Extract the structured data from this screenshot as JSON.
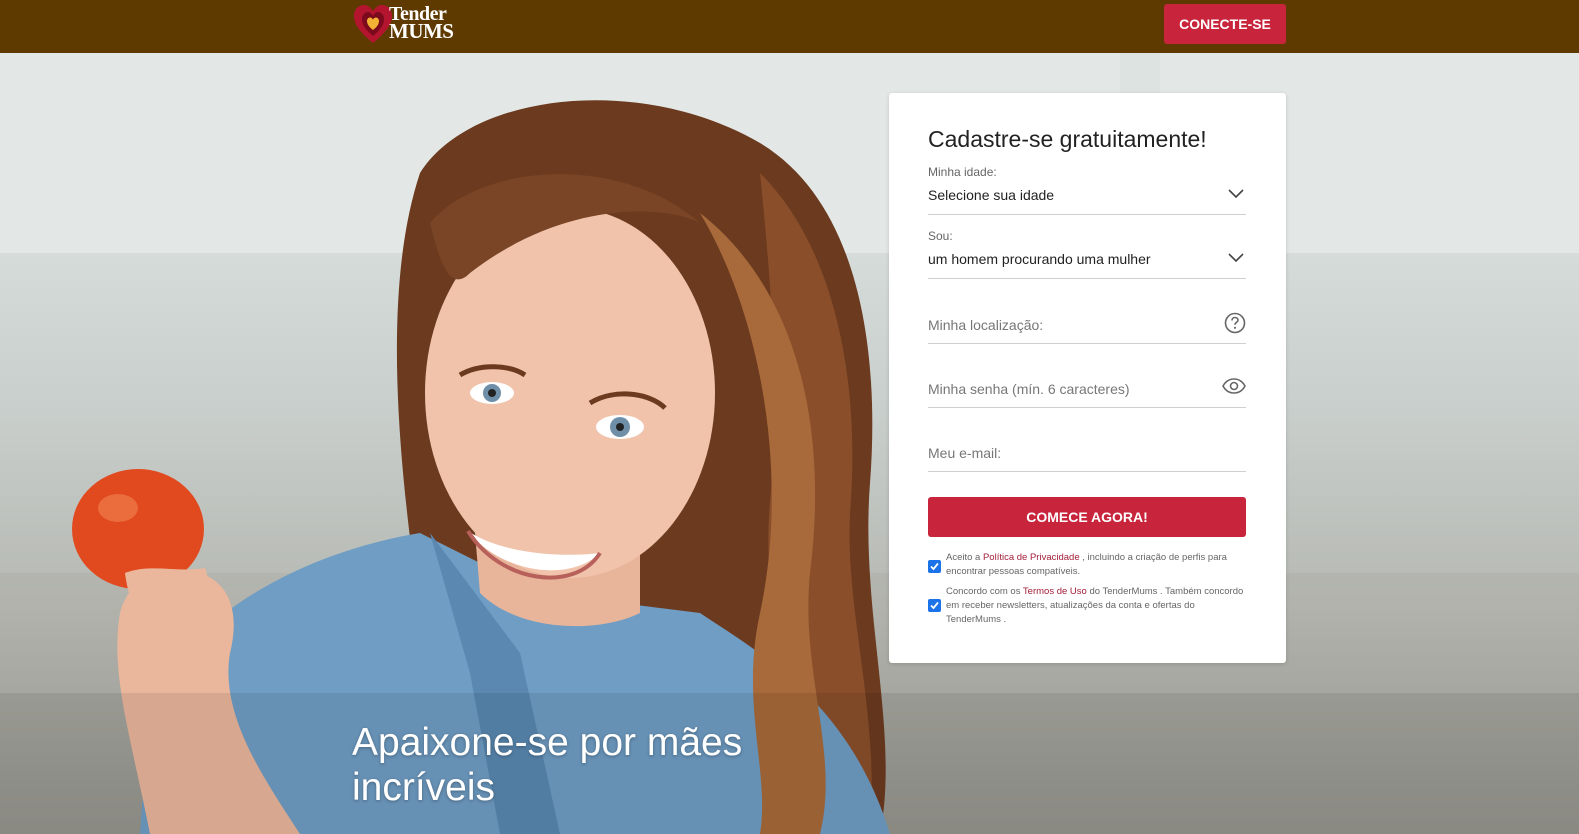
{
  "header": {
    "logo_line1": "Tender",
    "logo_line2": "MUMS",
    "login_label": "CONECTE-SE"
  },
  "hero": {
    "tagline_line1": "Apaixone-se por mães",
    "tagline_line2": "incríveis"
  },
  "form": {
    "title": "Cadastre-se gratuitamente!",
    "age": {
      "label": "Minha idade:",
      "value": "Selecione sua idade"
    },
    "gender": {
      "label": "Sou:",
      "value": "um homem procurando uma mulher"
    },
    "location": {
      "placeholder": "Minha localização:"
    },
    "password": {
      "placeholder": "Minha senha (mín. 6 caracteres)"
    },
    "email": {
      "placeholder": "Meu e-mail:"
    },
    "submit_label": "COMECE AGORA!",
    "consent_privacy": {
      "prefix": "Aceito a ",
      "link": "Política de Privacidade",
      "suffix": " , incluindo a criação de perfis para encontrar pessoas compatíveis.",
      "checked": true
    },
    "consent_terms": {
      "prefix": "Concordo com os ",
      "link": "Termos de Uso",
      "suffix": " do TenderMums . Também concordo em receber newsletters, atualizações da conta e ofertas do TenderMums .",
      "checked": true
    }
  },
  "colors": {
    "header_bg": "#5e3a00",
    "accent": "#c8243c",
    "link": "#a3203a",
    "checkbox": "#1a73e8"
  },
  "icons": {
    "location_help": "question-circle-icon",
    "password_toggle": "eye-icon",
    "select_arrow": "chevron-down-icon",
    "brand": "heart-logo-icon"
  }
}
